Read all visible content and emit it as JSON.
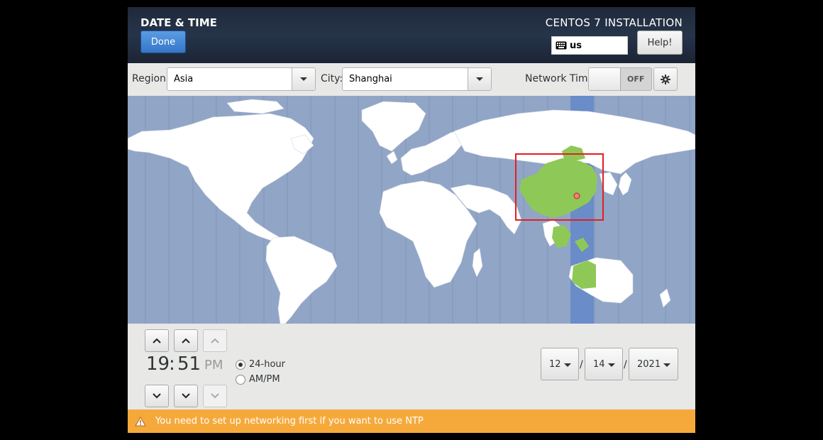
{
  "header": {
    "title": "DATE & TIME",
    "done_label": "Done",
    "product": "CENTOS 7 INSTALLATION",
    "keyboard_layout": "us",
    "help_label": "Help!"
  },
  "toolbar": {
    "region_label": "Region:",
    "region_value": "Asia",
    "city_label": "City:",
    "city_value": "Shanghai",
    "network_time_label": "Network Time",
    "network_time_state": "OFF"
  },
  "map": {
    "selected_timezone_highlight": "#8ec957",
    "ocean_color": "#91a5c6",
    "timezone_band_color": "#6a8cc8",
    "selection_box_color": "#e02020"
  },
  "time": {
    "hours": "19",
    "separator": ":",
    "minutes": "51",
    "ampm": "PM",
    "format_24": "24-hour",
    "format_ampm": "AM/PM",
    "selected_format": "24-hour"
  },
  "date": {
    "month": "12",
    "day": "14",
    "year": "2021",
    "separator": "/"
  },
  "warning": {
    "text": "You need to set up networking first if you want to use NTP",
    "color": "#f6a93b"
  }
}
